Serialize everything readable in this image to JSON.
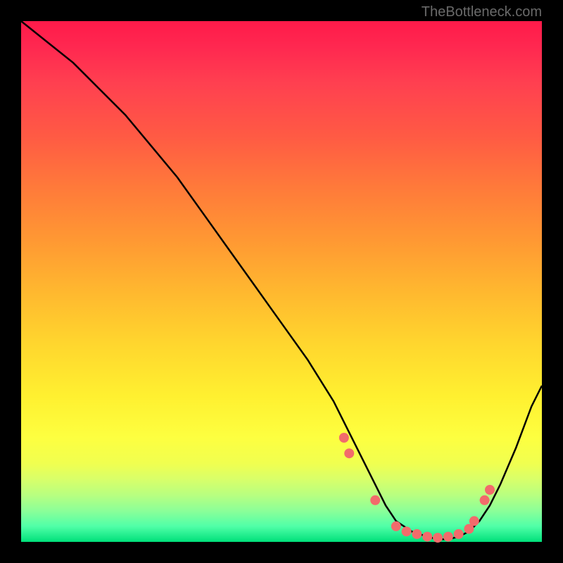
{
  "watermark": "TheBottleneck.com",
  "chart_data": {
    "type": "line",
    "title": "",
    "xlabel": "",
    "ylabel": "",
    "xlim": [
      0,
      100
    ],
    "ylim": [
      0,
      100
    ],
    "series": [
      {
        "name": "bottleneck-curve",
        "x": [
          0,
          5,
          10,
          15,
          20,
          25,
          30,
          35,
          40,
          45,
          50,
          55,
          60,
          62,
          65,
          68,
          70,
          72,
          75,
          78,
          80,
          82,
          84,
          86,
          88,
          90,
          92,
          95,
          98,
          100
        ],
        "values": [
          100,
          96,
          92,
          87,
          82,
          76,
          70,
          63,
          56,
          49,
          42,
          35,
          27,
          23,
          17,
          11,
          7,
          4,
          2,
          1,
          0.5,
          0.5,
          1,
          2,
          4,
          7,
          11,
          18,
          26,
          30
        ]
      }
    ],
    "markers": {
      "name": "highlight-dots",
      "color": "#f26b6b",
      "points": [
        {
          "x": 62,
          "y": 20
        },
        {
          "x": 63,
          "y": 17
        },
        {
          "x": 68,
          "y": 8
        },
        {
          "x": 72,
          "y": 3
        },
        {
          "x": 74,
          "y": 2
        },
        {
          "x": 76,
          "y": 1.5
        },
        {
          "x": 78,
          "y": 1
        },
        {
          "x": 80,
          "y": 0.8
        },
        {
          "x": 82,
          "y": 1
        },
        {
          "x": 84,
          "y": 1.5
        },
        {
          "x": 86,
          "y": 2.5
        },
        {
          "x": 87,
          "y": 4
        },
        {
          "x": 89,
          "y": 8
        },
        {
          "x": 90,
          "y": 10
        }
      ]
    }
  }
}
